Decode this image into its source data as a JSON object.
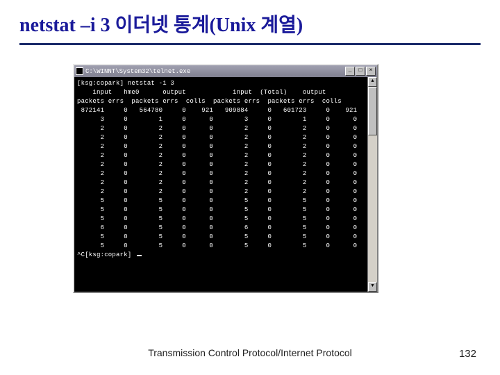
{
  "slide": {
    "title": "netstat –i 3 이더넷 통계(Unix 계열)",
    "footer": "Transmission Control Protocol/Internet Protocol",
    "page": "132"
  },
  "window": {
    "title": "C:\\WINNT\\System32\\telnet.exe",
    "btn_min": "_",
    "btn_max": "□",
    "btn_close": "×",
    "scroll_up": "▲",
    "scroll_down": "▼"
  },
  "terminal": {
    "prompt1": "[ksg:copark] netstat -i 3",
    "header1": "    input   hme0      output            input  (Total)    output",
    "header2": "packets errs  packets errs  colls  packets errs  packets errs  colls",
    "rows": [
      [
        "872141",
        "0",
        "564780",
        "0",
        "921",
        "909884",
        "0",
        "601723",
        "0",
        "921"
      ],
      [
        "3",
        "0",
        "1",
        "0",
        "0",
        "3",
        "0",
        "1",
        "0",
        "0"
      ],
      [
        "2",
        "0",
        "2",
        "0",
        "0",
        "2",
        "0",
        "2",
        "0",
        "0"
      ],
      [
        "2",
        "0",
        "2",
        "0",
        "0",
        "2",
        "0",
        "2",
        "0",
        "0"
      ],
      [
        "2",
        "0",
        "2",
        "0",
        "0",
        "2",
        "0",
        "2",
        "0",
        "0"
      ],
      [
        "2",
        "0",
        "2",
        "0",
        "0",
        "2",
        "0",
        "2",
        "0",
        "0"
      ],
      [
        "2",
        "0",
        "2",
        "0",
        "0",
        "2",
        "0",
        "2",
        "0",
        "0"
      ],
      [
        "2",
        "0",
        "2",
        "0",
        "0",
        "2",
        "0",
        "2",
        "0",
        "0"
      ],
      [
        "2",
        "0",
        "2",
        "0",
        "0",
        "2",
        "0",
        "2",
        "0",
        "0"
      ],
      [
        "2",
        "0",
        "2",
        "0",
        "0",
        "2",
        "0",
        "2",
        "0",
        "0"
      ],
      [
        "5",
        "0",
        "5",
        "0",
        "0",
        "5",
        "0",
        "5",
        "0",
        "0"
      ],
      [
        "5",
        "0",
        "5",
        "0",
        "0",
        "5",
        "0",
        "5",
        "0",
        "0"
      ],
      [
        "5",
        "0",
        "5",
        "0",
        "0",
        "5",
        "0",
        "5",
        "0",
        "0"
      ],
      [
        "6",
        "0",
        "5",
        "0",
        "0",
        "6",
        "0",
        "5",
        "0",
        "0"
      ],
      [
        "5",
        "0",
        "5",
        "0",
        "0",
        "5",
        "0",
        "5",
        "0",
        "0"
      ],
      [
        "5",
        "0",
        "5",
        "0",
        "0",
        "5",
        "0",
        "5",
        "0",
        "0"
      ]
    ],
    "prompt2": "^C[ksg:copark] "
  }
}
